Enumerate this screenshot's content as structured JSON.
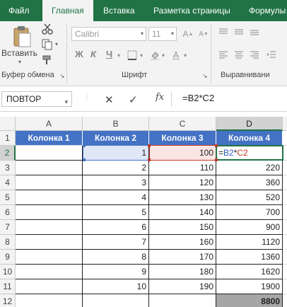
{
  "tabs": [
    {
      "label": "Файл"
    },
    {
      "label": "Главная"
    },
    {
      "label": "Вставка"
    },
    {
      "label": "Разметка страницы"
    },
    {
      "label": "Формулы"
    }
  ],
  "ribbon": {
    "paste_label": "Вставить",
    "clipboard_label": "Буфер обмена",
    "font_label": "Шрифт",
    "align_label": "Выравнивани",
    "font_name": "Calibri",
    "font_size": "11",
    "bold": "Ж",
    "italic": "К",
    "underline": "Ч"
  },
  "formula_bar": {
    "name_box": "ПОВТОР",
    "fx": "fx",
    "formula": "=B2*C2"
  },
  "columns": [
    "A",
    "B",
    "C",
    "D"
  ],
  "rows": [
    "1",
    "2",
    "3",
    "4",
    "5",
    "6",
    "7",
    "8",
    "9",
    "10",
    "11",
    "12"
  ],
  "table": {
    "headers": [
      "Колонка 1",
      "Колонка 2",
      "Колонка 3",
      "Колонка 4"
    ],
    "col2": [
      "1",
      "2",
      "3",
      "4",
      "5",
      "6",
      "7",
      "8",
      "9",
      "10"
    ],
    "col3": [
      "100",
      "110",
      "120",
      "130",
      "140",
      "150",
      "160",
      "170",
      "180",
      "190"
    ],
    "col4": [
      "",
      "220",
      "360",
      "520",
      "700",
      "900",
      "1120",
      "1360",
      "1620",
      "1900"
    ],
    "edit_parts": [
      "=",
      "B2",
      "*",
      "C2"
    ],
    "total": "8800"
  },
  "colors": {
    "accent": "#217346",
    "header_fill": "#4472c4",
    "total_fill": "#a6a6a6"
  },
  "icons": [
    "cut-icon",
    "copy-icon",
    "format-painter-icon",
    "paste-icon",
    "cancel-icon",
    "enter-icon",
    "fx-icon"
  ]
}
